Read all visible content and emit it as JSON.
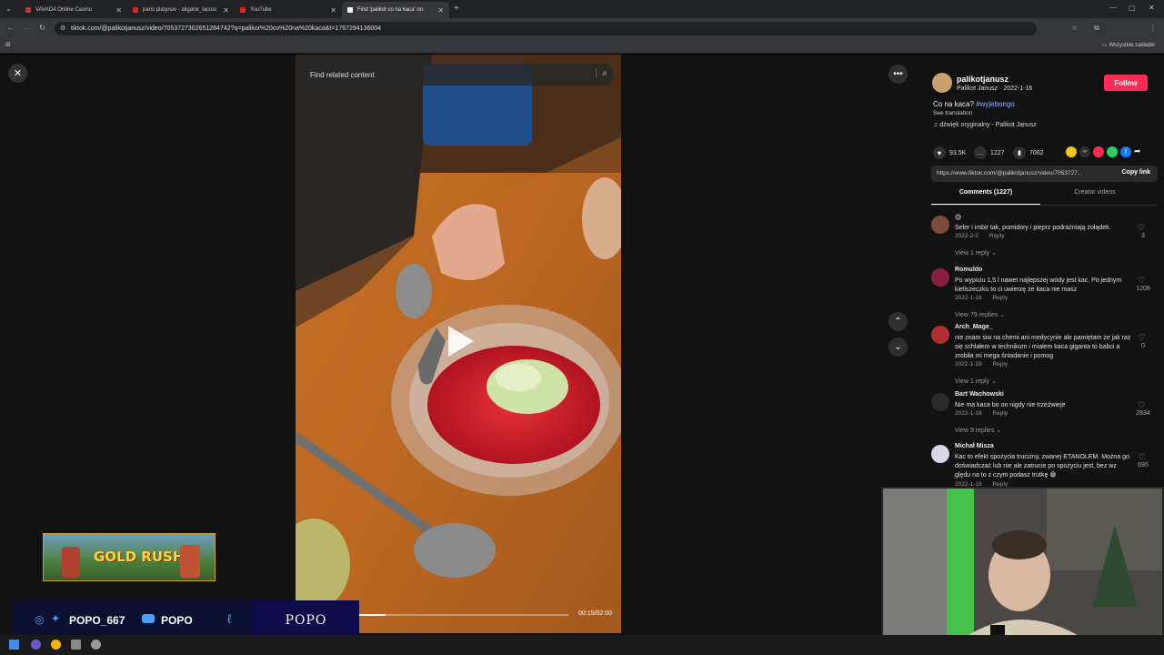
{
  "browser": {
    "tabs": [
      {
        "label": "VAVADA Online Casino",
        "favicon_color": "#c0392b"
      },
      {
        "label": "paris platynov - aligator_lacost",
        "favicon_color": "#e62117"
      },
      {
        "label": "YouTube",
        "favicon_color": "#e62117"
      },
      {
        "label": "Find 'palikot co na kaca' on",
        "favicon_color": "#ffffff"
      }
    ],
    "url": "tiktok.com/@palikotjanusz/video/7053727302651284742?q=palikot%20co%20na%20kaca&t=1767294136004",
    "bookmarks_label": "Wszystkie zakładki"
  },
  "video": {
    "search_placeholder": "Find related content",
    "time": "00:15/02:00",
    "progress": 0.125
  },
  "post": {
    "username": "palikotjanusz",
    "display_name": "Palikot Janusz · 2022-1-16",
    "follow_label": "Follow",
    "caption": "Co na kaca?",
    "hashtag": "#wyjebongo",
    "see_translation": "See translation",
    "sound": "dźwięk oryginalny - Palikot Janusz",
    "likes": "93.5K",
    "comments": "1227",
    "saves": "7062",
    "link": "https://www.tiktok.com/@palikotjanusz/video/7053727...",
    "copy_link": "Copy link",
    "tab_comments": "Comments (1227)",
    "tab_creator": "Creator videos"
  },
  "comments": [
    {
      "name": "😋",
      "text": "Seler i imbir tak, pomidory i pieprz podrażniają żołądek.",
      "date": "2022-2-5",
      "reply": "Reply",
      "likes": "3",
      "view": "View 1 reply",
      "avatar_color": "#7a4a3a"
    },
    {
      "name": "Romuldo",
      "text": "Po wypiciu 1,5 l nawet najlepszej wódy jest kac. Po jednym kieliszeczku to ci uwierzę ze kaca nie masz",
      "date": "2022-1-16",
      "reply": "Reply",
      "likes": "1208",
      "view": "View 79 replies",
      "avatar_color": "#8a2040"
    },
    {
      "name": "Arch_Mage_",
      "text": "nie znam siw na chemi ani medycynie ale pamiętam że jak raz się schlałem w technikum i miałem kaca giganta to babci a zrobiła mi mega śniadanie i pomog",
      "date": "2022-1-19",
      "reply": "Reply",
      "likes": "0",
      "view": "View 1 reply",
      "avatar_color": "#b03030"
    },
    {
      "name": "Bart Wachowski",
      "text": "Nie ma kaca bo on nigdy nie trzeźwieje",
      "date": "2022-1-16",
      "reply": "Reply",
      "likes": "2834",
      "view": "View 9 replies",
      "avatar_color": "#2a2a2a"
    },
    {
      "name": "Michał Misza",
      "text": "Kac to efekt spożycia trucizny, zwanej ETANOLEM. Można go doświadczać lub nie ale zatrucie po spożyciu jest, bez wz ględu na to z czym podasz trutkę 😁",
      "date": "2022-1-16",
      "reply": "Reply",
      "likes": "695",
      "view": "",
      "avatar_color": "#d8d8e8"
    }
  ],
  "overlay": {
    "game_banner": "GOLD RUSH",
    "social_handle": "POPO_667",
    "youtube_name": "POPO",
    "brand": "POPO"
  },
  "colors": {
    "follow": "#fe2c55",
    "hashtag": "#8fb4ff"
  }
}
